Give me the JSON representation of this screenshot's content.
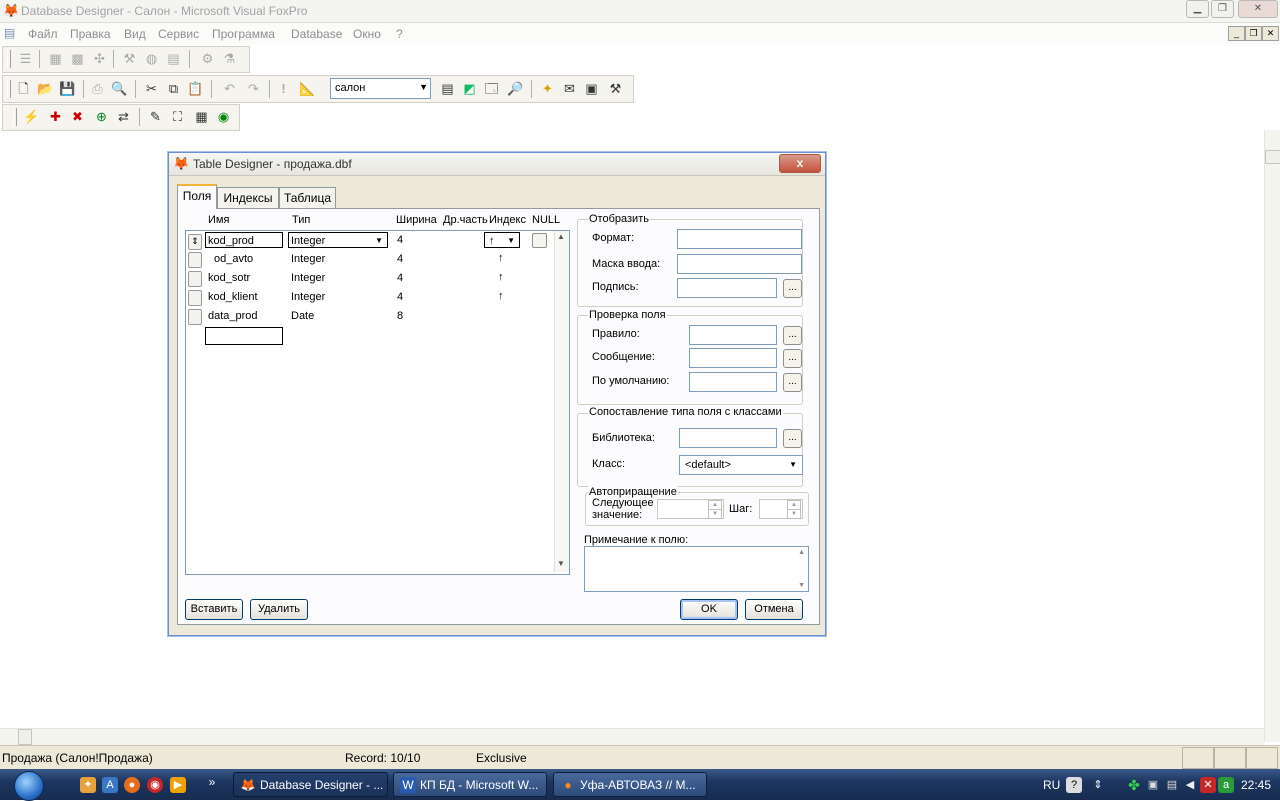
{
  "app": {
    "title": "Database Designer - Салон - Microsoft Visual FoxPro",
    "window_buttons": {
      "minimize": "▁",
      "restore": "❐",
      "close": "✕"
    }
  },
  "menu": [
    "Файл",
    "Правка",
    "Вид",
    "Сервис",
    "Программа",
    "Database",
    "Окно",
    "?"
  ],
  "toolbar": {
    "database_combo": "салон"
  },
  "dialog": {
    "title": "Table Designer - продажа.dbf",
    "close_label": "x",
    "tabs": [
      "Поля",
      "Индексы",
      "Таблица"
    ],
    "columns": [
      "Имя",
      "Тип",
      "Ширина",
      "Др.часть",
      "Индекс",
      "NULL"
    ],
    "fields": [
      {
        "name": "kod_prod",
        "type": "Integer",
        "width": "4",
        "index": "↑"
      },
      {
        "name": "od_avto",
        "type": "Integer",
        "width": "4",
        "index": "↑"
      },
      {
        "name": "kod_sotr",
        "type": "Integer",
        "width": "4",
        "index": "↑"
      },
      {
        "name": "kod_klient",
        "type": "Integer",
        "width": "4",
        "index": "↑"
      },
      {
        "name": "data_prod",
        "type": "Date",
        "width": "8",
        "index": ""
      }
    ],
    "display_group": {
      "title": "Отобразить",
      "format": "Формат:",
      "mask": "Маска ввода:",
      "caption": "Подпись:"
    },
    "validation_group": {
      "title": "Проверка поля",
      "rule": "Правило:",
      "message": "Сообщение:",
      "default": "По умолчанию:"
    },
    "class_group": {
      "title": "Сопоставление типа поля с классами",
      "library": "Библиотека:",
      "class": "Класс:",
      "class_value": "<default>"
    },
    "autoinc_group": {
      "title": "Автоприращение",
      "next_line1": "Следующее",
      "next_line2": "значение:",
      "step": "Шаг:"
    },
    "comment_label": "Примечание к полю:",
    "ellipsis": "...",
    "buttons": {
      "insert": "Вставить",
      "delete": "Удалить",
      "ok": "OK",
      "cancel": "Отмена"
    }
  },
  "statusbar": {
    "table": "Продажа (Салон!Продажа)",
    "record": "Record: 10/10",
    "mode": "Exclusive"
  },
  "taskbar": {
    "tasks": [
      {
        "label": "Database Designer - ...",
        "active": true
      },
      {
        "label": "КП БД - Microsoft W...",
        "active": false
      },
      {
        "label": "Уфа-АВТОВАЗ // М...",
        "active": false
      }
    ],
    "lang": "RU",
    "clock": "22:45"
  }
}
